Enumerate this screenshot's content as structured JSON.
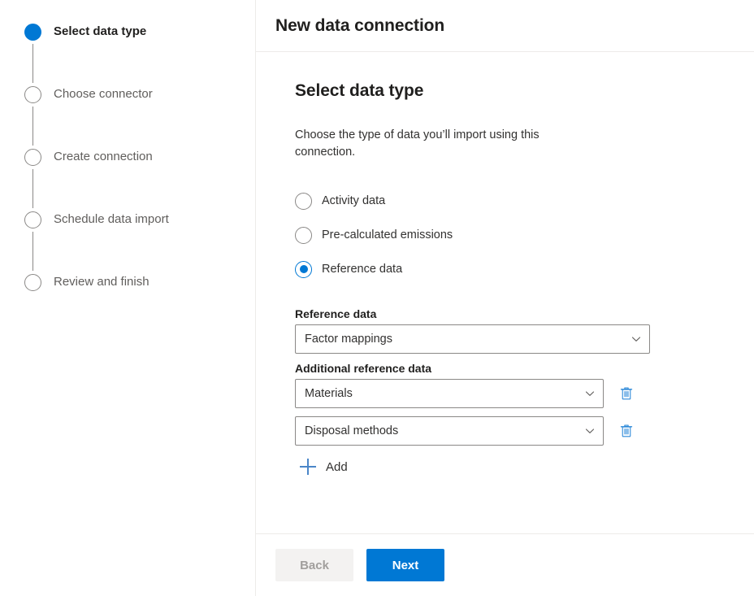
{
  "wizard": {
    "steps": [
      {
        "label": "Select data type",
        "state": "active"
      },
      {
        "label": "Choose connector",
        "state": "inactive"
      },
      {
        "label": "Create connection",
        "state": "inactive"
      },
      {
        "label": "Schedule data import",
        "state": "inactive"
      },
      {
        "label": "Review and finish",
        "state": "inactive"
      }
    ]
  },
  "header": {
    "title": "New data connection"
  },
  "main": {
    "section_title": "Select data type",
    "description": "Choose the type of data you’ll import using this connection.",
    "data_type_options": [
      {
        "label": "Activity data",
        "checked": false
      },
      {
        "label": "Pre-calculated emissions",
        "checked": false
      },
      {
        "label": "Reference data",
        "checked": true
      }
    ],
    "reference_data": {
      "label": "Reference data",
      "value": "Factor mappings"
    },
    "additional_reference_data": {
      "label": "Additional reference data",
      "rows": [
        {
          "value": "Materials",
          "delete_label": "Delete"
        },
        {
          "value": "Disposal methods",
          "delete_label": "Delete"
        }
      ],
      "add_label": "Add"
    }
  },
  "footer": {
    "back_label": "Back",
    "next_label": "Next"
  },
  "colors": {
    "accent": "#0078d4",
    "icon_blue": "#2b88d8",
    "divider": "#edebe9",
    "muted_text": "#605e5c"
  }
}
